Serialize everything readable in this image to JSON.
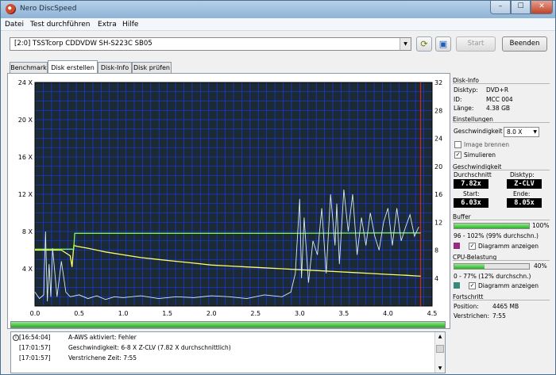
{
  "window": {
    "title": "Nero DiscSpeed",
    "min": "–",
    "max": "☐",
    "close": "✕"
  },
  "menu": [
    "Datei",
    "Test durchführen",
    "Extra",
    "Hilfe"
  ],
  "toolbar": {
    "drive": "[2:0]   TSSTcorp CDDVDW SH-S223C SB05",
    "start": "Start",
    "close": "Beenden"
  },
  "tabs": [
    "Benchmark",
    "Disk erstellen",
    "Disk-Info",
    "Disk prüfen"
  ],
  "chart_data": {
    "type": "line",
    "x_ticks": [
      "0.0",
      "0.5",
      "1.0",
      "1.5",
      "2.0",
      "2.5",
      "3.0",
      "3.5",
      "4.0",
      "4.5"
    ],
    "y_left_ticks": [
      "4 X",
      "8 X",
      "12 X",
      "16 X",
      "20 X",
      "24 X"
    ],
    "y_right_ticks": [
      "4",
      "8",
      "12",
      "16",
      "20",
      "24",
      "28",
      "32"
    ],
    "xlim": [
      0,
      4.5
    ],
    "ylim_left": [
      0,
      24
    ],
    "ylim_right": [
      0,
      32
    ],
    "background": "#1b2a33",
    "grid_color": "#1a37d6",
    "marker_x": 4.37,
    "marker_color": "#c8281e",
    "series": [
      {
        "color": "#ffff66",
        "x": [
          0,
          0.3,
          0.4,
          0.42,
          0.44,
          0.48,
          0.6,
          0.8,
          1.0,
          1.2,
          1.4,
          1.6,
          1.8,
          2.0,
          2.2,
          2.4,
          2.6,
          2.8,
          3.0,
          3.2,
          3.4,
          3.6,
          3.8,
          4.0,
          4.2,
          4.37
        ],
        "y": [
          6.0,
          6.0,
          5.4,
          4.2,
          6.5,
          6.4,
          6.2,
          5.8,
          5.5,
          5.2,
          5.0,
          4.8,
          4.6,
          4.4,
          4.3,
          4.2,
          4.1,
          4.0,
          3.9,
          3.8,
          3.7,
          3.6,
          3.5,
          3.4,
          3.3,
          3.2
        ]
      },
      {
        "color": "#7cf44a",
        "x": [
          0,
          0.44,
          0.45,
          1.0,
          2.0,
          3.0,
          4.0,
          4.37
        ],
        "y": [
          6.1,
          6.1,
          7.8,
          7.8,
          7.8,
          7.8,
          7.85,
          7.85
        ]
      },
      {
        "color": "#d7ecee",
        "x": [
          0,
          0.05,
          0.1,
          0.12,
          0.14,
          0.16,
          0.18,
          0.2,
          0.25,
          0.3,
          0.35,
          0.4,
          0.5,
          0.6,
          0.7,
          0.8,
          0.9,
          1.0,
          1.2,
          1.4,
          1.6,
          1.8,
          2.0,
          2.2,
          2.4,
          2.6,
          2.8,
          2.9,
          2.95,
          3.0,
          3.02,
          3.05,
          3.1,
          3.15,
          3.2,
          3.25,
          3.3,
          3.35,
          3.4,
          3.42,
          3.45,
          3.5,
          3.55,
          3.6,
          3.65,
          3.7,
          3.75,
          3.8,
          3.85,
          3.9,
          3.95,
          4.0,
          4.05,
          4.1,
          4.15,
          4.2,
          4.25,
          4.3,
          4.35
        ],
        "y": [
          1.5,
          0.8,
          1.2,
          8.0,
          0.5,
          4.5,
          1.0,
          6.2,
          1.0,
          4.8,
          1.5,
          1.0,
          1.2,
          0.8,
          1.1,
          0.7,
          1.0,
          0.9,
          1.1,
          0.8,
          1.0,
          0.9,
          1.1,
          1.0,
          0.8,
          1.2,
          1.0,
          1.5,
          3.5,
          11.5,
          3.0,
          9.5,
          2.5,
          7.0,
          5.5,
          10.5,
          3.5,
          12.0,
          6.5,
          11.0,
          4.5,
          12.5,
          8.0,
          12.0,
          5.5,
          9.5,
          6.5,
          10.0,
          7.5,
          6.0,
          9.0,
          10.5,
          6.5,
          10.5,
          7.0,
          8.5,
          9.8,
          7.5,
          8.5
        ]
      }
    ]
  },
  "diskinfo": {
    "header": "Disk-Info",
    "rows": [
      {
        "k": "Disktyp:",
        "v": "DVD+R"
      },
      {
        "k": "ID:",
        "v": "MCC 004"
      },
      {
        "k": "Länge:",
        "v": "4.38 GB"
      }
    ]
  },
  "settings": {
    "header": "Einstellungen",
    "speed_label": "Geschwindigkeit",
    "speed_value": "8.0 X",
    "image_burn": "Image brennen",
    "simulate": "Simulieren"
  },
  "speed": {
    "header": "Geschwindigkeit",
    "avg_label": "Durchschnitt",
    "avg": "7.82x",
    "type_label": "Disktyp:",
    "type": "Z-CLV",
    "start_label": "Start:",
    "start": "6.03x",
    "end_label": "Ende:",
    "end": "8.05x"
  },
  "buffer": {
    "header": "Buffer",
    "percent": 100,
    "pct_text": "100%",
    "line": "96 - 102% (99% durchschn.)",
    "show_diagram": "Diagramm anzeigen",
    "color": "#9a2a80"
  },
  "cpu": {
    "header": "CPU-Belastung",
    "percent": 40,
    "pct_text": "40%",
    "line": "0 - 77% (12% durchschn.)",
    "show_diagram": "Diagramm anzeigen",
    "color": "#3a8a7a"
  },
  "progress": {
    "header": "Fortschritt",
    "pos_label": "Position:",
    "pos": "4465 MB",
    "elapsed_label": "Verstrichen:",
    "elapsed": "7:55",
    "main_percent": 100
  },
  "log": [
    {
      "time": "[16:54:04]",
      "msg": "A-AWS aktiviert: Fehler"
    },
    {
      "time": "[17:01:57]",
      "msg": "Geschwindigkeit: 6-8 X Z-CLV (7.82 X durchschnittlich)"
    },
    {
      "time": "[17:01:57]",
      "msg": "Verstrichene Zeit: 7:55"
    }
  ]
}
